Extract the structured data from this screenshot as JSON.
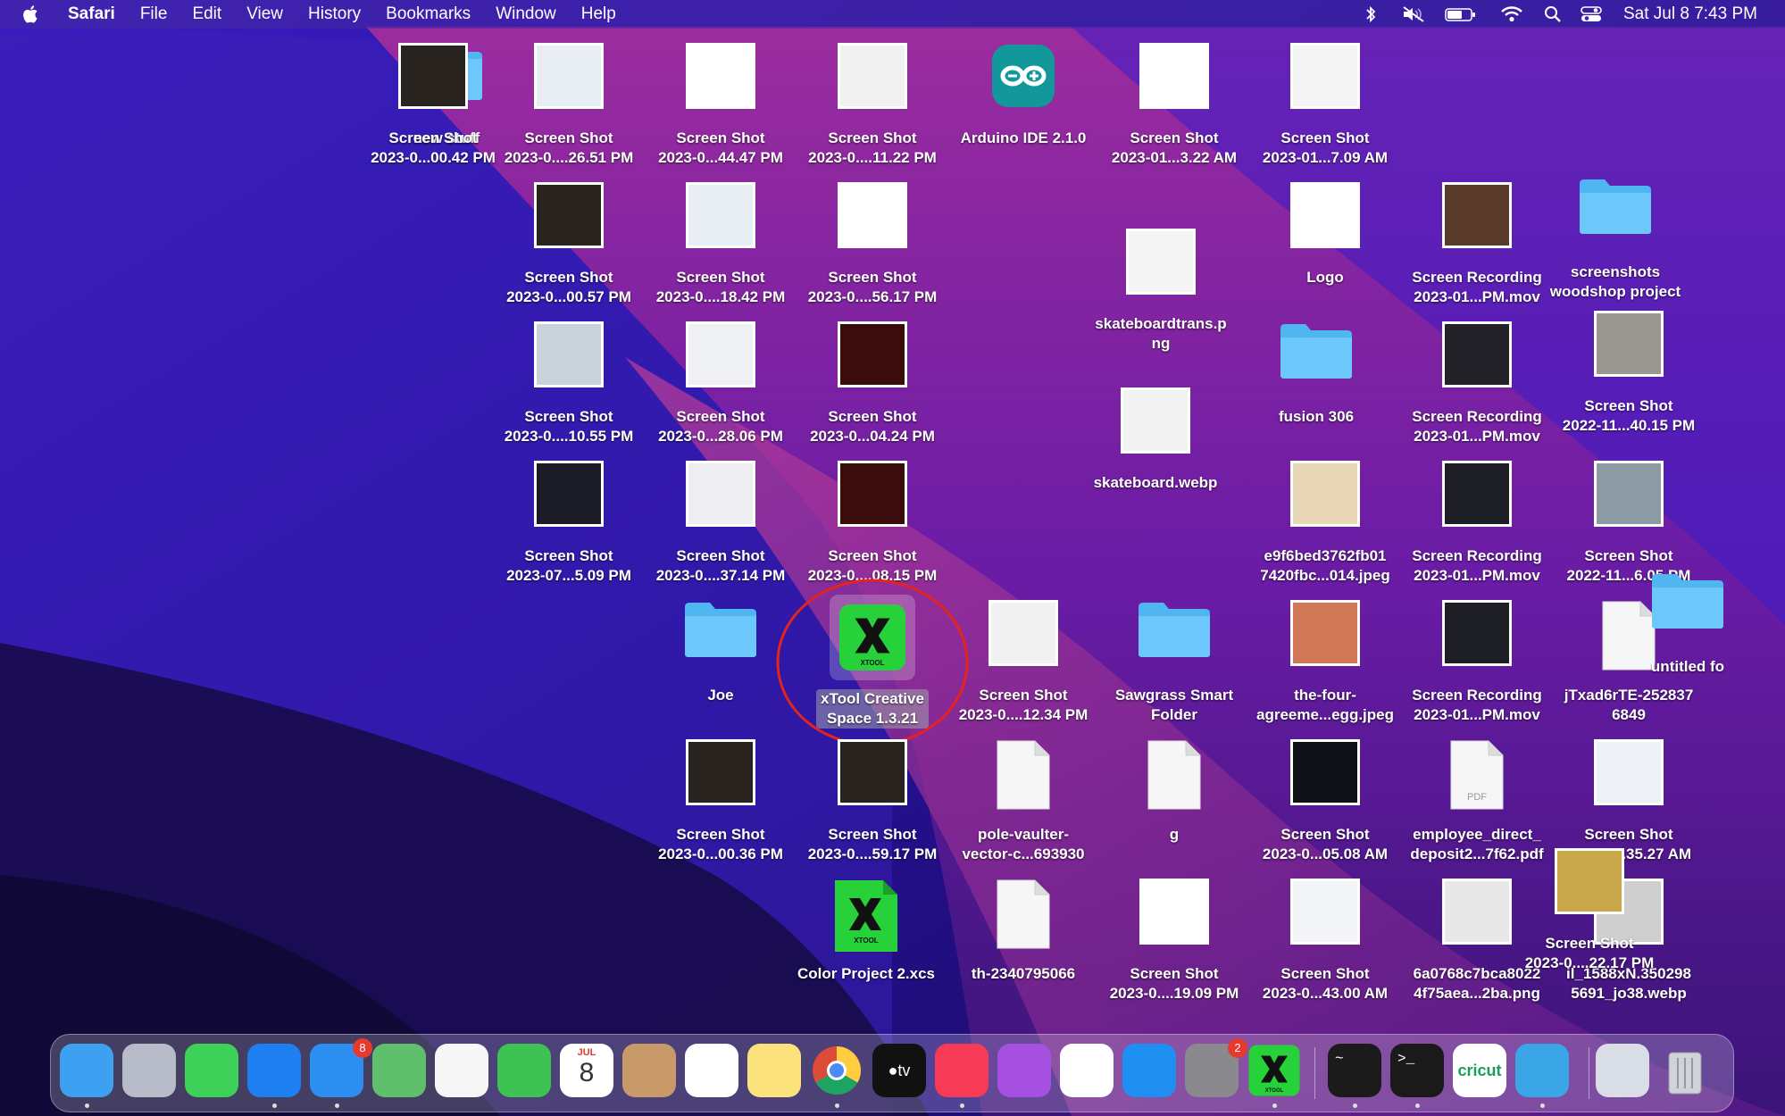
{
  "menubar": {
    "app_name": "Safari",
    "menus": [
      "File",
      "Edit",
      "View",
      "History",
      "Bookmarks",
      "Window",
      "Help"
    ],
    "clock": "Sat Jul 8  7:43 PM"
  },
  "desktop": {
    "items": [
      {
        "name": "new stuff",
        "kind": "folder"
      },
      {
        "name": "Screen Shot\n2023-0...00.42 PM",
        "kind": "photo",
        "color": "#2a2420"
      },
      {
        "name": "Screen Shot\n2023-0....26.51 PM",
        "kind": "photo",
        "color": "#e8eef3"
      },
      {
        "name": "Screen Shot\n2023-0...44.47 PM",
        "kind": "photo",
        "color": "#ffffff"
      },
      {
        "name": "Screen Shot\n2023-0....11.22 PM",
        "kind": "photo",
        "color": "#f1f1f1"
      },
      {
        "name": "Arduino IDE 2.1.0",
        "kind": "app",
        "color": "#12979b"
      },
      {
        "name": "Screen Shot\n2023-01...3.22 AM",
        "kind": "photo",
        "color": "#ffffff"
      },
      {
        "name": "Screen Shot\n2023-01...7.09 AM",
        "kind": "photo",
        "color": "#f4f4f4"
      },
      {
        "name": "Screen Shot\n2023-0...00.57 PM",
        "kind": "photo",
        "color": "#2a2420"
      },
      {
        "name": "Screen Shot\n2023-0....18.42 PM",
        "kind": "photo",
        "color": "#e8eef3"
      },
      {
        "name": "Screen Shot\n2023-0....56.17 PM",
        "kind": "photo",
        "color": "#ffffff"
      },
      {
        "name": "skateboardtrans.p\nng",
        "kind": "photo",
        "color": "#f5f5f5"
      },
      {
        "name": "Logo",
        "kind": "photo",
        "color": "#ffffff"
      },
      {
        "name": "Screen Recording\n2023-01...PM.mov",
        "kind": "photo",
        "color": "#5a3a2a"
      },
      {
        "name": "screenshots\nwoodshop project",
        "kind": "folder"
      },
      {
        "name": "Screen Shot\n2023-0....10.55 PM",
        "kind": "photo",
        "color": "#c9d3dc"
      },
      {
        "name": "Screen Shot\n2023-0...28.06 PM",
        "kind": "photo",
        "color": "#eef0f3"
      },
      {
        "name": "Screen Shot\n2023-0...04.24 PM",
        "kind": "photo",
        "color": "#3a0c0c"
      },
      {
        "name": "skateboard.webp",
        "kind": "photo",
        "color": "#f2f2f2"
      },
      {
        "name": "fusion 306",
        "kind": "folder"
      },
      {
        "name": "Screen Recording\n2023-01...PM.mov",
        "kind": "photo",
        "color": "#222228"
      },
      {
        "name": "Screen Shot\n2022-11...40.15 PM",
        "kind": "photo",
        "color": "#9a9690"
      },
      {
        "name": "Screen Shot\n2023-07...5.09 PM",
        "kind": "photo",
        "color": "#1c1c28"
      },
      {
        "name": "Screen Shot\n2023-0....37.14 PM",
        "kind": "photo",
        "color": "#eeeef2"
      },
      {
        "name": "Screen Shot\n2023-0....08.15 PM",
        "kind": "photo",
        "color": "#3a0c0c"
      },
      {
        "name": "e9f6bed3762fb01\n7420fbc...014.jpeg",
        "kind": "photo",
        "color": "#e9d8b8"
      },
      {
        "name": "Screen Recording\n2023-01...PM.mov",
        "kind": "photo",
        "color": "#1e1e26"
      },
      {
        "name": "Screen Shot\n2022-11...6.05 PM",
        "kind": "photo",
        "color": "#8e9aa4"
      },
      {
        "name": "Joe",
        "kind": "folder"
      },
      {
        "name": "xTool Creative\nSpace 1.3.21",
        "kind": "xtool",
        "selected": true
      },
      {
        "name": "Screen Shot\n2023-0....12.34 PM",
        "kind": "photo",
        "color": "#f1f1f1"
      },
      {
        "name": "Sawgrass Smart\nFolder",
        "kind": "folder"
      },
      {
        "name": "the-four-\nagreeme...egg.jpeg",
        "kind": "photo",
        "color": "#d07858"
      },
      {
        "name": "Screen Recording\n2023-01...PM.mov",
        "kind": "photo",
        "color": "#1e1e26"
      },
      {
        "name": "jTxad6rTE-252837\n6849",
        "kind": "doc"
      },
      {
        "name": "untitled fo",
        "kind": "folder"
      },
      {
        "name": "Screen Shot\n2023-0...00.36 PM",
        "kind": "photo",
        "color": "#2a2420"
      },
      {
        "name": "Screen Shot\n2023-0....59.17 PM",
        "kind": "photo",
        "color": "#2a2420"
      },
      {
        "name": "pole-vaulter-\nvector-c...693930",
        "kind": "doc"
      },
      {
        "name": "g",
        "kind": "doc"
      },
      {
        "name": "Screen Shot\n2023-0...05.08 AM",
        "kind": "photo",
        "color": "#101018"
      },
      {
        "name": "employee_direct_\ndeposit2...7f62.pdf",
        "kind": "pdf"
      },
      {
        "name": "Screen Shot\n2023-0...35.27 AM",
        "kind": "photo",
        "color": "#eef2f6"
      },
      {
        "name": "Color Project 2.xcs",
        "kind": "xtooldoc"
      },
      {
        "name": "th-2340795066",
        "kind": "doc"
      },
      {
        "name": "Screen Shot\n2023-0....19.09 PM",
        "kind": "photo",
        "color": "#ffffff"
      },
      {
        "name": "Screen Shot\n2023-0...43.00 AM",
        "kind": "photo",
        "color": "#f2f4f8"
      },
      {
        "name": "6a0768c7bca8022\n4f75aea...2ba.png",
        "kind": "photo",
        "color": "#e8e8e8"
      },
      {
        "name": "il_1588xN.350298\n5691_jo38.webp",
        "kind": "photo",
        "color": "#cfcfcf"
      },
      {
        "name": "Screen Shot\n2023-0....22.17 PM",
        "kind": "photo",
        "color": "#c8a84a"
      }
    ]
  },
  "dock": {
    "apps": [
      {
        "name": "Finder",
        "color": "#3ea0f0",
        "running": true
      },
      {
        "name": "Launchpad",
        "color": "#b8bcc8",
        "running": false
      },
      {
        "name": "Messages",
        "color": "#3ed15a",
        "running": false
      },
      {
        "name": "Safari",
        "color": "#1e7ff0",
        "running": true
      },
      {
        "name": "Mail",
        "color": "#2d8ef2",
        "running": true,
        "badge": "8"
      },
      {
        "name": "Maps",
        "color": "#5fbf6c",
        "running": false
      },
      {
        "name": "Photos",
        "color": "#f6f6f6",
        "running": false
      },
      {
        "name": "FaceTime",
        "color": "#3ec253",
        "running": false
      },
      {
        "name": "Calendar",
        "color": "#ffffff",
        "running": false,
        "month": "JUL",
        "day": "8"
      },
      {
        "name": "Contacts",
        "color": "#c89a6a",
        "running": false
      },
      {
        "name": "Reminders",
        "color": "#ffffff",
        "running": false
      },
      {
        "name": "Notes",
        "color": "#fbe27a",
        "running": false
      },
      {
        "name": "Chrome",
        "color": "#ffffff",
        "running": true
      },
      {
        "name": "TV",
        "color": "#111111",
        "running": false
      },
      {
        "name": "Music",
        "color": "#f73b56",
        "running": true
      },
      {
        "name": "Podcasts",
        "color": "#a550e0",
        "running": false
      },
      {
        "name": "News",
        "color": "#ffffff",
        "running": false
      },
      {
        "name": "App Store",
        "color": "#1f8ff2",
        "running": false
      },
      {
        "name": "System Settings",
        "color": "#8a8a8e",
        "running": false,
        "badge": "2"
      },
      {
        "name": "xTool Creative Space",
        "color": "#1ec51e",
        "running": true
      },
      {
        "name": "Activity Monitor",
        "color": "#1b1b1b",
        "running": true
      },
      {
        "name": "Terminal",
        "color": "#1a1a1a",
        "running": true
      },
      {
        "name": "Cricut",
        "color": "#ffffff",
        "running": false
      },
      {
        "name": "Sawgrass",
        "color": "#3aa6e6",
        "running": true
      },
      {
        "name": "Downloads stack",
        "color": "#d8dde6",
        "running": false
      },
      {
        "name": "Trash",
        "color": "#c8ccd2",
        "running": false
      }
    ]
  }
}
